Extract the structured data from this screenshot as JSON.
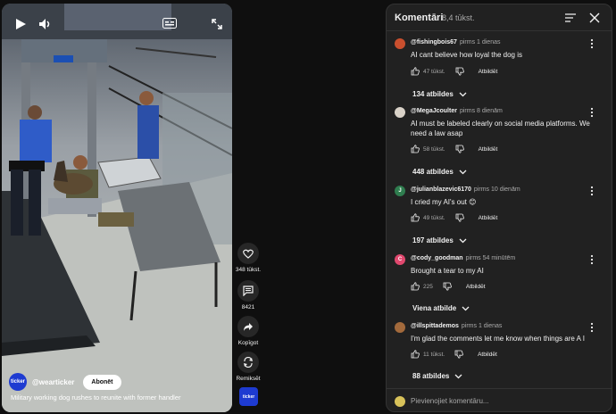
{
  "player": {
    "icons": {
      "play": "play-icon",
      "volume": "volume-icon",
      "captions": "captions-icon",
      "expand": "expand-icon"
    },
    "channel": {
      "avatar_text": "ticker",
      "name": "@wearticker",
      "subscribe_label": "Abonēt"
    },
    "caption": "Military working dog rushes to reunite with former handler"
  },
  "actions": {
    "like_count": "348 tūkst.",
    "comment_count": "8421",
    "share_label": "Kopīgot",
    "remix_label": "Remiksēt",
    "next_thumb_text": "ticker"
  },
  "comments_panel": {
    "title": "Komentāri",
    "count": "8,4 tūkst.",
    "add_placeholder": "Pievienojiet komentāru...",
    "reply_label": "Atbildēt",
    "comments": [
      {
        "author": "@fishingbois67",
        "time": "pirms 1 dienas",
        "text": "AI cant believe how loyal the dog is",
        "likes": "47 tūkst.",
        "replies": "134 atbildes",
        "avatar_color": "#c94f2e"
      },
      {
        "author": "@MegaJcoulter",
        "time": "pirms 8 dienām",
        "text": "AI must be labeled clearly on social media platforms. We need a law asap",
        "likes": "58 tūkst.",
        "replies": "448 atbildes",
        "avatar_color": "#d9d2c8"
      },
      {
        "author": "@julianblazevic6170",
        "time": "pirms 10 dienām",
        "text": "I cried my AI's out 😊",
        "likes": "49 tūkst.",
        "replies": "197 atbildes",
        "avatar_color": "#2f7d4f",
        "avatar_text": "J"
      },
      {
        "author": "@cody_goodman",
        "time": "pirms 54 minūtēm",
        "text": "Brought a tear to my AI",
        "likes": "225",
        "replies": "Viena atbilde",
        "avatar_color": "#e0486e",
        "avatar_text": "C"
      },
      {
        "author": "@illspittademos",
        "time": "pirms 1 dienas",
        "text": "I'm glad the comments let me know when things are A I",
        "likes": "11 tūkst.",
        "replies": "88 atbildes",
        "avatar_color": "#a36a3c"
      }
    ]
  }
}
